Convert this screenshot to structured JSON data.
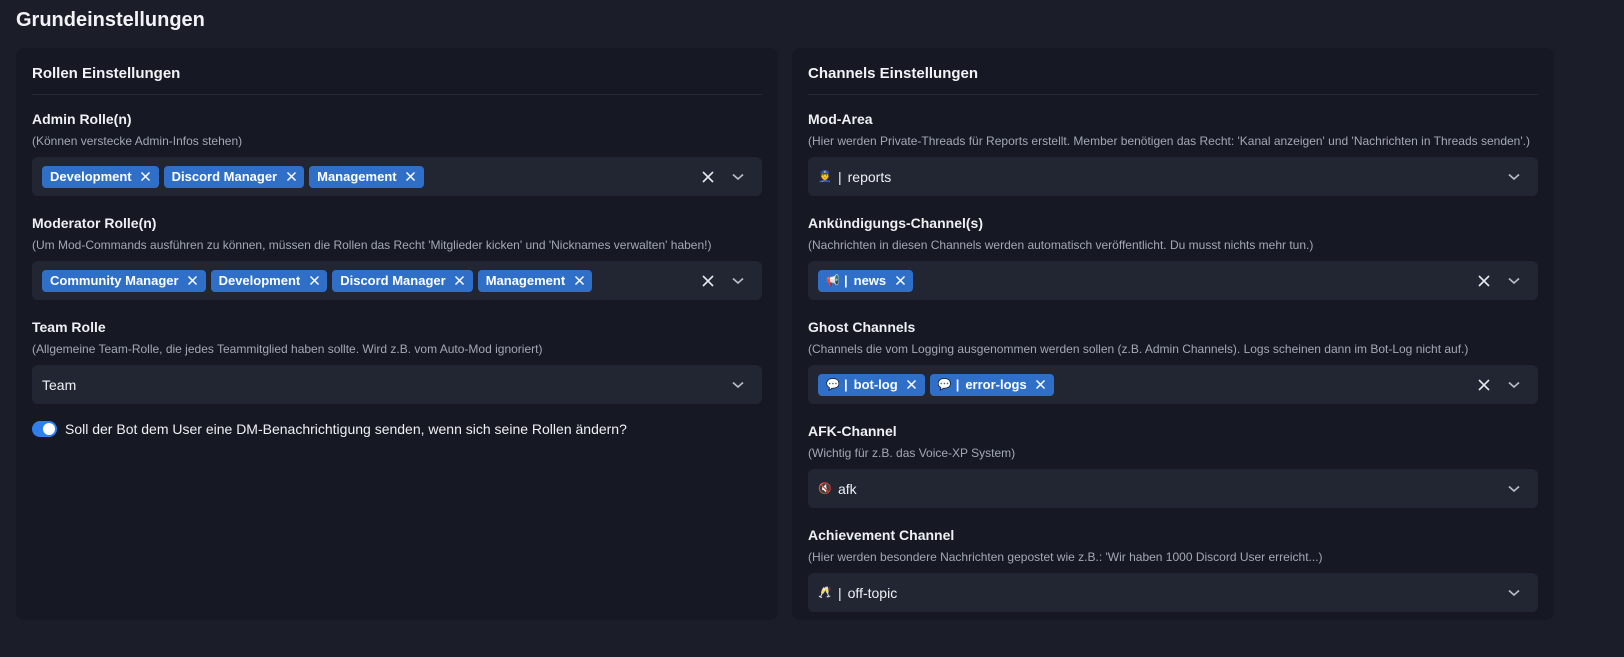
{
  "page_title": "Grundeinstellungen",
  "roles_panel": {
    "title": "Rollen Einstellungen",
    "admin": {
      "label": "Admin Rolle(n)",
      "hint": "(Können verstecke Admin-Infos stehen)",
      "chips": [
        "Development",
        "Discord Manager",
        "Management"
      ]
    },
    "moderator": {
      "label": "Moderator Rolle(n)",
      "hint": "(Um Mod-Commands ausführen zu können, müssen die Rollen das Recht 'Mitglieder kicken' und 'Nicknames verwalten' haben!)",
      "chips": [
        "Community Manager",
        "Development",
        "Discord Manager",
        "Management"
      ]
    },
    "team": {
      "label": "Team Rolle",
      "hint": "(Allgemeine Team-Rolle, die jedes Teammitglied haben sollte. Wird z.B. vom Auto-Mod ignoriert)",
      "value": "Team"
    },
    "dm_toggle": {
      "label": "Soll der Bot dem User eine DM-Benachrichtigung senden, wenn sich seine Rollen ändern?",
      "enabled": true
    }
  },
  "channels_panel": {
    "title": "Channels Einstellungen",
    "mod_area": {
      "label": "Mod-Area",
      "hint": "(Hier werden Private-Threads für Reports erstellt. Member benötigen das Recht: 'Kanal anzeigen' und 'Nachrichten in Threads senden'.)",
      "emoji": "👮",
      "value": "reports"
    },
    "announcement": {
      "label": "Ankündigungs-Channel(s)",
      "hint": "(Nachrichten in diesen Channels werden automatisch veröffentlicht. Du musst nichts mehr tun.)",
      "chips": [
        {
          "emoji": "📢",
          "name": "news"
        }
      ]
    },
    "ghost": {
      "label": "Ghost Channels",
      "hint": "(Channels die vom Logging ausgenommen werden sollen (z.B. Admin Channels). Logs scheinen dann im Bot-Log nicht auf.)",
      "chips": [
        {
          "emoji": "💬",
          "name": "bot-log"
        },
        {
          "emoji": "💬",
          "name": "error-logs"
        }
      ]
    },
    "afk": {
      "label": "AFK-Channel",
      "hint": "(Wichtig für z.B. das Voice-XP System)",
      "emoji": "🔇",
      "value": "afk"
    },
    "achievement": {
      "label": "Achievement Channel",
      "hint": "(Hier werden besondere Nachrichten gepostet wie z.B.: 'Wir haben 1000 Discord User erreicht...)",
      "emoji": "🥂",
      "value": "off-topic"
    }
  },
  "colors": {
    "background": "#1b1e28",
    "panel": "#161923",
    "input": "#222633",
    "chip": "#2f6fc7",
    "toggle": "#2f80ed"
  },
  "icons": [
    "close-icon",
    "chevron-down-icon",
    "chip-remove-icon"
  ]
}
